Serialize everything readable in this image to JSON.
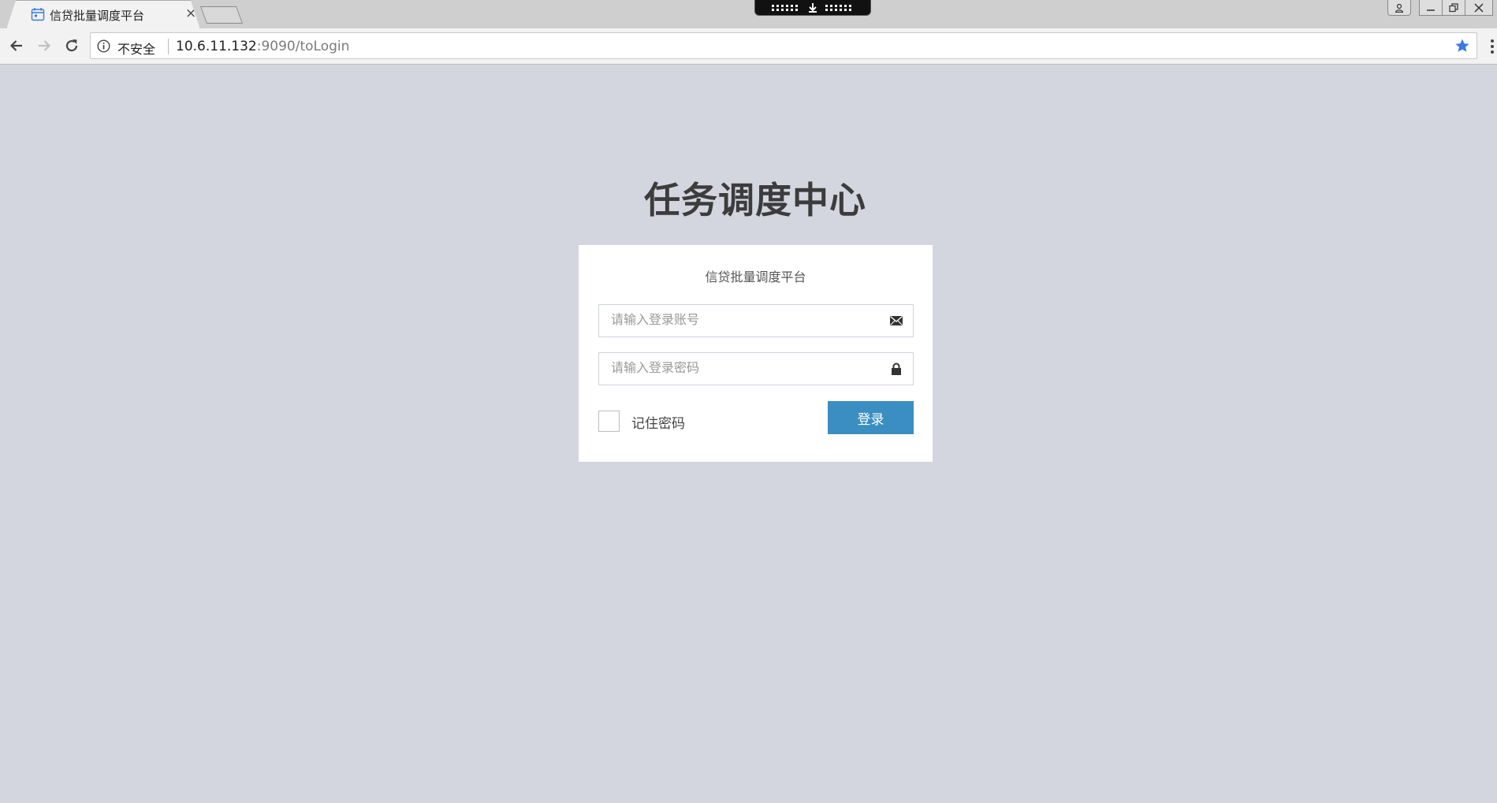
{
  "browser": {
    "tab": {
      "title": "信贷批量调度平台",
      "close_glyph": "×"
    },
    "address_bar": {
      "security_label": "不安全",
      "url_host": "10.6.11.132",
      "url_rest": ":9090/toLogin"
    }
  },
  "page": {
    "title": "任务调度中心",
    "card": {
      "subtitle": "信贷批量调度平台",
      "username_placeholder": "请输入登录账号",
      "password_placeholder": "请输入登录密码",
      "remember_label": "记住密码",
      "login_button": "登录"
    }
  },
  "colors": {
    "page_background": "#d3d6df",
    "button_blue": "#3a8ec1",
    "title_text": "#3c3c3c"
  },
  "icons": {
    "username": "envelope-icon",
    "password": "lock-icon",
    "tab": "calendar-icon",
    "bookmark": "star-icon"
  }
}
